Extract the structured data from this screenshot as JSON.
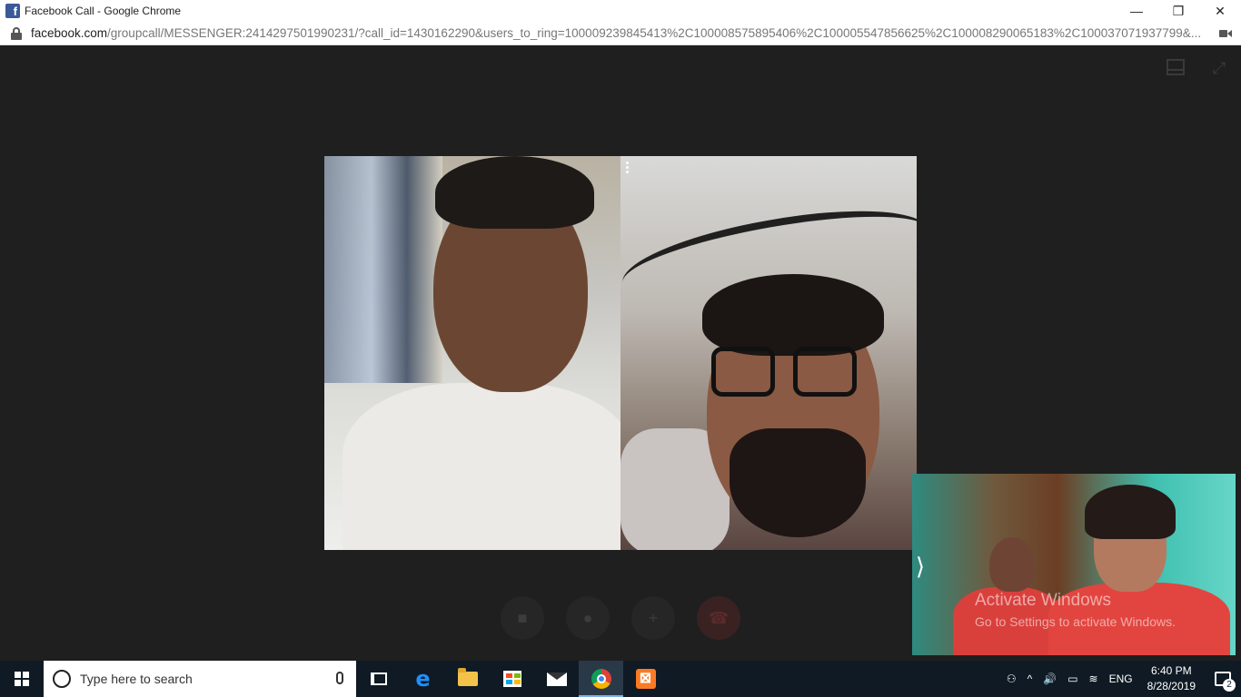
{
  "window": {
    "title": "Facebook Call - Google Chrome",
    "favicon_letter": "f",
    "controls": {
      "minimize": "—",
      "restore": "❐",
      "close": "✕"
    }
  },
  "address_bar": {
    "host": "facebook.com",
    "path": "/groupcall/MESSENGER:2414297501990231/?call_id=1430162290&users_to_ring=100009239845413%2C100008575895406%2C100005547856625%2C100008290065183%2C100037071937799&..."
  },
  "call": {
    "top_icons": {
      "layout": "layout-icon",
      "expand": "⤢"
    },
    "self_view_toggle": "⟩",
    "controls": [
      {
        "name": "video-toggle",
        "glyph": "■"
      },
      {
        "name": "mute",
        "glyph": "●"
      },
      {
        "name": "add-person",
        "glyph": "+"
      },
      {
        "name": "end-call",
        "glyph": "☎"
      }
    ]
  },
  "watermark": {
    "line1": "Activate Windows",
    "line2": "Go to Settings to activate Windows."
  },
  "taskbar": {
    "search_placeholder": "Type here to search",
    "tray": {
      "people": "⚇",
      "chevron": "^",
      "volume": "🔊",
      "battery": "▭",
      "wifi": "≋",
      "language": "ENG",
      "time": "6:40 PM",
      "date": "8/28/2019",
      "notification_count": "2"
    }
  }
}
